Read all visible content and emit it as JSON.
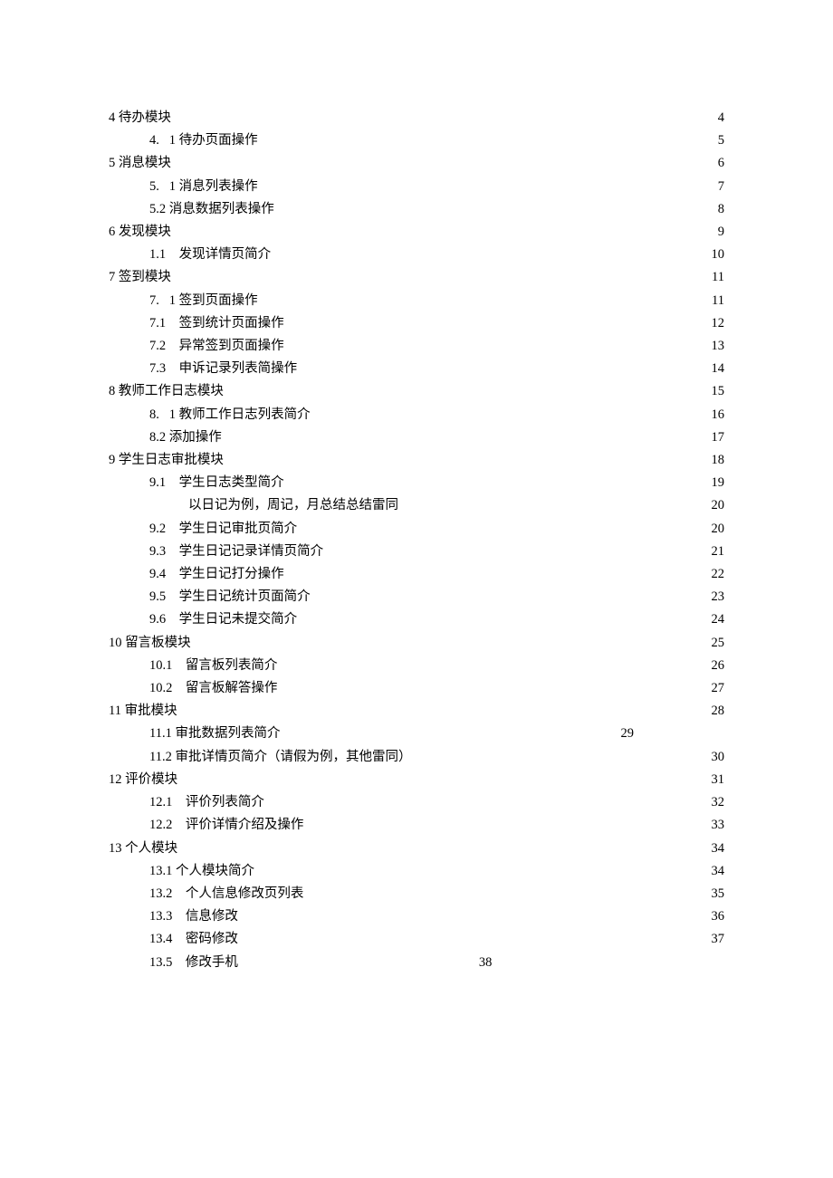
{
  "toc": [
    {
      "indent": 0,
      "prefix": "4",
      "gap": " ",
      "title": "待办模块",
      "page": "4",
      "leader": true
    },
    {
      "indent": 1,
      "prefix": "4.",
      "gap": "   ",
      "title": "1 待办页面操作",
      "page": "5",
      "leader": true
    },
    {
      "indent": 0,
      "prefix": "5",
      "gap": " ",
      "title": "消息模块",
      "page": "6",
      "leader": true
    },
    {
      "indent": 1,
      "prefix": "5.",
      "gap": "   ",
      "title": "1 消息列表操作",
      "page": "7",
      "leader": true
    },
    {
      "indent": 1,
      "prefix": "",
      "gap": "",
      "title": "5.2 消息数据列表操作",
      "page": "8",
      "leader": true
    },
    {
      "indent": 0,
      "prefix": "6",
      "gap": " ",
      "title": "发现模块",
      "page": "9",
      "leader": true
    },
    {
      "indent": 1,
      "prefix": "1.1",
      "gap": "    ",
      "title": "发现详情页简介",
      "page": "10",
      "leader": true
    },
    {
      "indent": 0,
      "prefix": "7",
      "gap": " ",
      "title": "签到模块",
      "page": "11",
      "leader": true
    },
    {
      "indent": 1,
      "prefix": "7.",
      "gap": "   ",
      "title": "1 签到页面操作",
      "page": "11",
      "leader": true
    },
    {
      "indent": 1,
      "prefix": "7.1",
      "gap": "    ",
      "title": "签到统计页面操作",
      "page": "12",
      "leader": true
    },
    {
      "indent": 1,
      "prefix": "7.2",
      "gap": "    ",
      "title": "异常签到页面操作",
      "page": "13",
      "leader": true
    },
    {
      "indent": 1,
      "prefix": "7.3",
      "gap": "    ",
      "title": "申诉记录列表简操作",
      "page": "14",
      "leader": true
    },
    {
      "indent": 0,
      "prefix": "8",
      "gap": " ",
      "title": "教师工作日志模块",
      "page": "15",
      "leader": true
    },
    {
      "indent": 1,
      "prefix": "8.",
      "gap": "   ",
      "title": "1 教师工作日志列表简介",
      "page": "16",
      "leader": true
    },
    {
      "indent": 1,
      "prefix": "",
      "gap": "",
      "title": "8.2 添加操作",
      "page": "17",
      "leader": true
    },
    {
      "indent": 0,
      "prefix": "9",
      "gap": " ",
      "title": "学生日志审批模块",
      "page": "18",
      "leader": true
    },
    {
      "indent": 1,
      "prefix": "9.1",
      "gap": "    ",
      "title": "学生日志类型简介",
      "page": "19",
      "leader": true
    },
    {
      "indent": 2,
      "prefix": "",
      "gap": "",
      "title": "以日记为例，周记，月总结总结雷同",
      "page": "20",
      "leader": true
    },
    {
      "indent": 1,
      "prefix": "9.2",
      "gap": "    ",
      "title": "学生日记审批页简介",
      "page": "20",
      "leader": true
    },
    {
      "indent": 1,
      "prefix": "9.3",
      "gap": "    ",
      "title": "学生日记记录详情页简介",
      "page": "21",
      "leader": true
    },
    {
      "indent": 1,
      "prefix": "9.4",
      "gap": "    ",
      "title": "学生日记打分操作",
      "page": "22",
      "leader": true
    },
    {
      "indent": 1,
      "prefix": "9.5",
      "gap": "    ",
      "title": "学生日记统计页面简介",
      "page": "23",
      "leader": true
    },
    {
      "indent": 1,
      "prefix": "9.6",
      "gap": "    ",
      "title": "学生日记未提交简介",
      "page": "24",
      "leader": true
    },
    {
      "indent": 0,
      "prefix": "10",
      "gap": " ",
      "title": "留言板模块",
      "page": "25",
      "leader": true
    },
    {
      "indent": 1,
      "prefix": "10.1",
      "gap": "    ",
      "title": "留言板列表简介",
      "page": "26",
      "leader": true
    },
    {
      "indent": 1,
      "prefix": "10.2",
      "gap": "    ",
      "title": "留言板解答操作",
      "page": "27",
      "leader": true
    },
    {
      "indent": 0,
      "prefix": "11",
      "gap": " ",
      "title": "审批模块",
      "page": "28",
      "leader": true
    },
    {
      "indent": 1,
      "prefix": "",
      "gap": "",
      "title": "11.1 审批数据列表简介",
      "page": "29",
      "leader": true,
      "short": true
    },
    {
      "indent": 1,
      "prefix": "",
      "gap": "",
      "title": "11.2 审批详情页简介（请假为例，其他雷同）",
      "page": "30",
      "leader": true
    },
    {
      "indent": 0,
      "prefix": "12",
      "gap": " ",
      "title": "评价模块",
      "page": "31",
      "leader": true
    },
    {
      "indent": 1,
      "prefix": "12.1",
      "gap": "    ",
      "title": "评价列表简介",
      "page": "32",
      "leader": true
    },
    {
      "indent": 1,
      "prefix": "12.2",
      "gap": "    ",
      "title": "评价详情介绍及操作",
      "page": "33",
      "leader": true
    },
    {
      "indent": 0,
      "prefix": "13",
      "gap": " ",
      "title": "个人模块",
      "page": "34",
      "leader": true
    },
    {
      "indent": 1,
      "prefix": "",
      "gap": "",
      "title": "13.1 个人模块简介",
      "page": "34",
      "leader": true
    },
    {
      "indent": 1,
      "prefix": "13.2",
      "gap": "    ",
      "title": "个人信息修改页列表",
      "page": "35",
      "leader": true
    },
    {
      "indent": 1,
      "prefix": "13.3",
      "gap": "    ",
      "title": "信息修改",
      "page": "36",
      "leader": true
    },
    {
      "indent": 1,
      "prefix": "13.4",
      "gap": "    ",
      "title": "密码修改",
      "page": "37",
      "leader": true
    },
    {
      "indent": 1,
      "prefix": "13.5",
      "gap": "    ",
      "title": "修改手机",
      "page": "38",
      "leader": false,
      "half": true
    }
  ]
}
